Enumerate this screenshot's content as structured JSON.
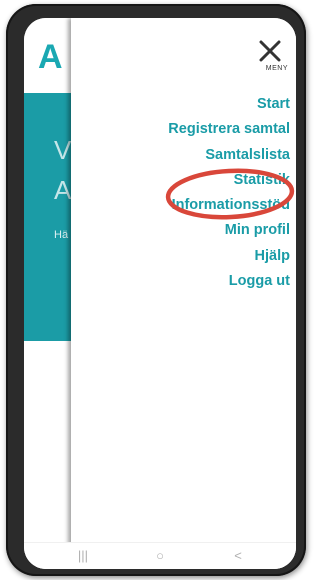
{
  "background_page": {
    "logo_text": "A",
    "hero_letters": [
      "V",
      "A"
    ],
    "hero_small_text": "Hä"
  },
  "menu": {
    "close_label": "MENY",
    "items": [
      {
        "label": "Start"
      },
      {
        "label": "Registrera samtal"
      },
      {
        "label": "Samtalslista"
      },
      {
        "label": "Statistik"
      },
      {
        "label": "Informationsstöd"
      },
      {
        "label": "Min profil"
      },
      {
        "label": "Hjälp"
      },
      {
        "label": "Logga ut"
      }
    ]
  },
  "annotation": {
    "highlighted_item": "Statistik",
    "color": "#d9473a"
  },
  "navbar": {
    "recent_glyph": "|||",
    "home_glyph": "○",
    "back_glyph": "<"
  },
  "colors": {
    "accent": "#1a9ca7",
    "hero": "#1b9ca6",
    "frame": "#2b2b2b"
  }
}
